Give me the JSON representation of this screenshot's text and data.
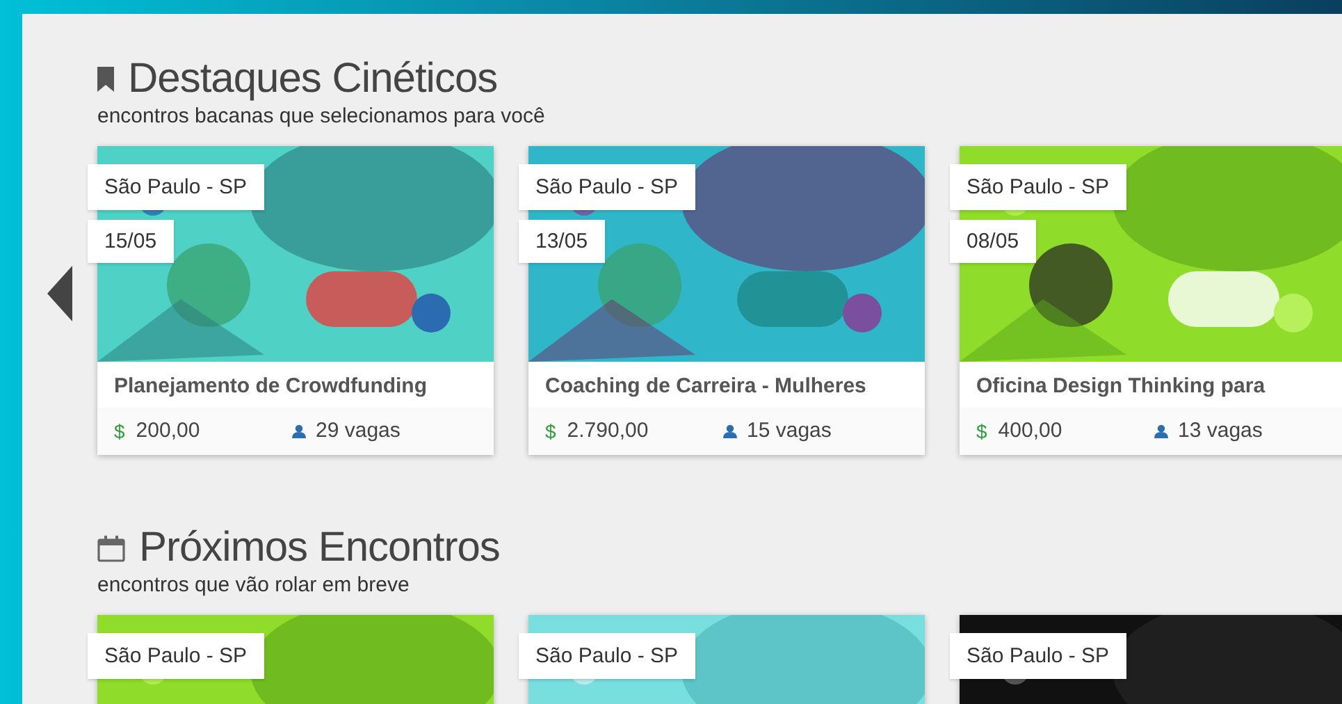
{
  "sections": [
    {
      "kind": "bookmark",
      "title": "Destaques Cinéticos",
      "subtitle": "encontros bacanas que selecionamos para você",
      "show_prev": true,
      "cards": [
        {
          "location": "São Paulo - SP",
          "date": "15/05",
          "title": "Planejamento de Crowdfunding",
          "currency": "$",
          "price": "200,00",
          "seats": "29 vagas"
        },
        {
          "location": "São Paulo - SP",
          "date": "13/05",
          "title": "Coaching de Carreira - Mulheres",
          "currency": "$",
          "price": "2.790,00",
          "seats": "15 vagas"
        },
        {
          "location": "São Paulo - SP",
          "date": "08/05",
          "title": "Oficina Design Thinking para",
          "currency": "$",
          "price": "400,00",
          "seats": "13 vagas"
        }
      ]
    },
    {
      "kind": "calendar",
      "title": "Próximos Encontros",
      "subtitle": "encontros que vão rolar em breve",
      "show_prev": false,
      "cards": [
        {
          "location": "São Paulo - SP"
        },
        {
          "location": "São Paulo - SP"
        },
        {
          "location": "São Paulo - SP"
        }
      ]
    }
  ]
}
